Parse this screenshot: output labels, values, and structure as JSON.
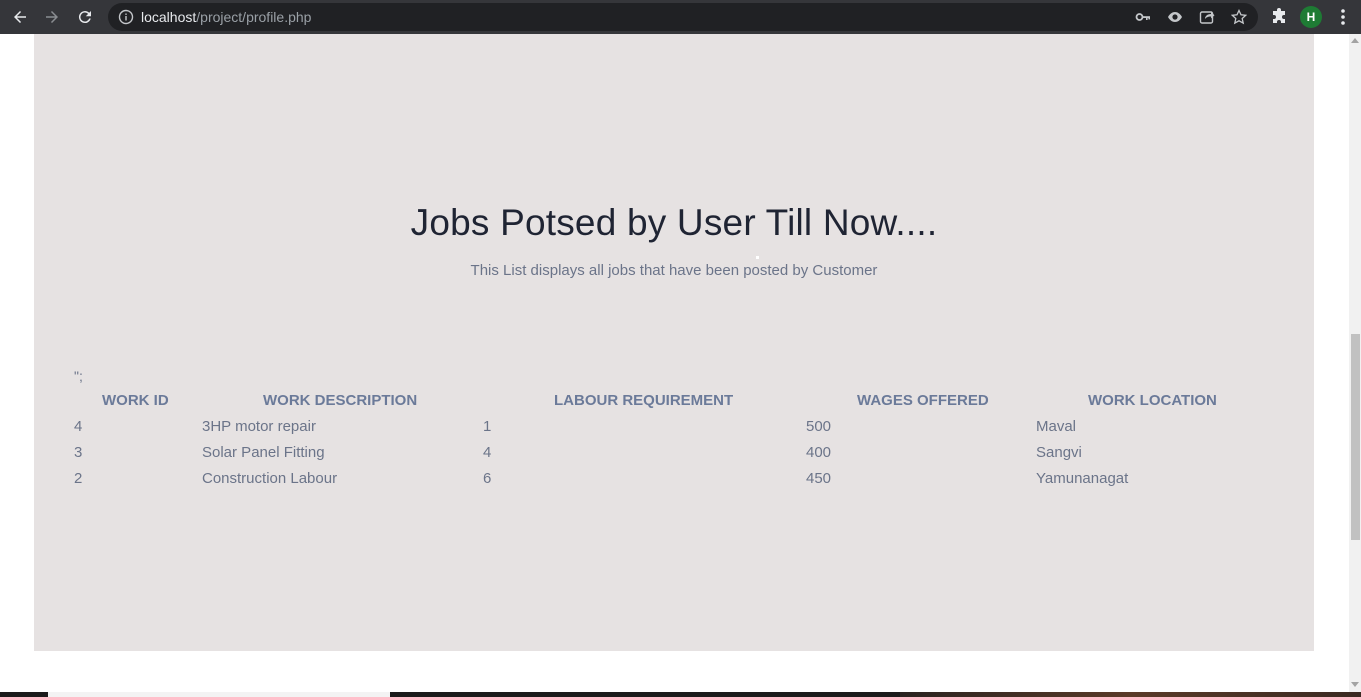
{
  "browser": {
    "url_host": "localhost",
    "url_path": "/project/profile.php",
    "profile_initial": "H"
  },
  "section": {
    "title": "Jobs Potsed by User Till Now....",
    "subtitle": "This List displays all jobs that have been posted by Customer",
    "stray_text": "\";"
  },
  "table": {
    "headers": [
      "WORK ID",
      "WORK DESCRIPTION",
      "LABOUR REQUIREMENT",
      "WAGES OFFERED",
      "WORK LOCATION"
    ],
    "rows": [
      [
        "4",
        "3HP motor repair",
        "1",
        "500",
        "Maval"
      ],
      [
        "3",
        "Solar Panel Fitting",
        "4",
        "400",
        "Sangvi"
      ],
      [
        "2",
        "Construction Labour",
        "6",
        "450",
        "Yamunanagat"
      ]
    ]
  },
  "colors": {
    "panel_bg": "#e6e2e2",
    "title": "#1f2433",
    "header_text": "#6b7a99",
    "body_text": "#6b7489"
  }
}
